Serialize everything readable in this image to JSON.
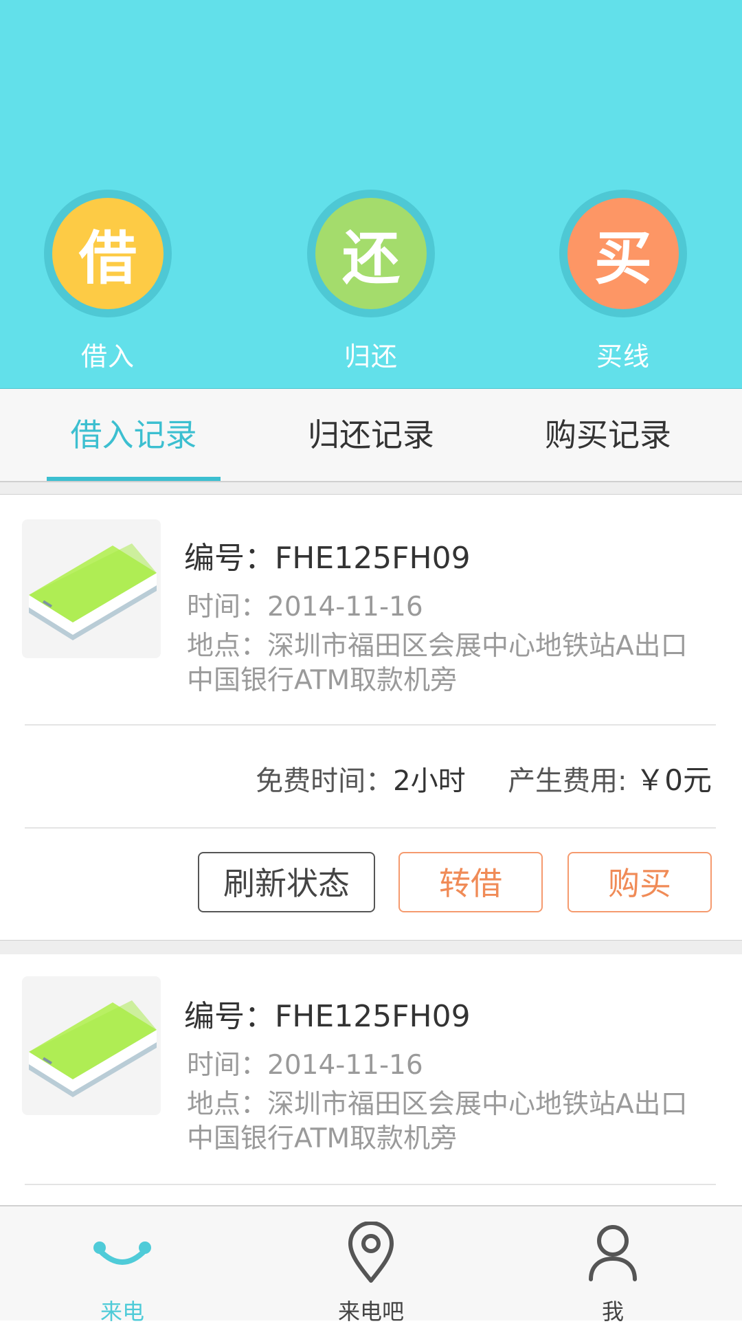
{
  "header": {
    "actions": [
      {
        "glyph": "借",
        "label": "借入",
        "color": "#fdcb45"
      },
      {
        "glyph": "还",
        "label": "归还",
        "color": "#a4dc6c"
      },
      {
        "glyph": "买",
        "label": "买线",
        "color": "#fd9665"
      }
    ],
    "background": "#62e0ea"
  },
  "tabs": {
    "items": [
      "借入记录",
      "归还记录",
      "购买记录"
    ],
    "active_index": 0,
    "active_color": "#3cbfd0"
  },
  "records": [
    {
      "thumbnail_icon": "power-bank-image",
      "id_text": "编号：FHE125FH09",
      "time_text": "时间：2014-11-16",
      "place_line1": "地点：深圳市福田区会展中心地铁站A出口",
      "place_line2": "中国银行ATM取款机旁",
      "free_time_label": "免费时间：",
      "free_time_value": "2小时",
      "fee_label": "产生费用:",
      "fee_value": "￥0元",
      "buttons": {
        "refresh": "刷新状态",
        "lend": "转借",
        "buy": "购买"
      }
    },
    {
      "thumbnail_icon": "power-bank-image",
      "id_text": "编号：FHE125FH09",
      "time_text": "时间：2014-11-16",
      "place_line1": "地点：深圳市福田区会展中心地铁站A出口",
      "place_line2": "中国银行ATM取款机旁"
    }
  ],
  "bottom_nav": {
    "items": [
      {
        "label": "来电",
        "icon": "smile-icon",
        "active": true
      },
      {
        "label": "来电吧",
        "icon": "location-pin-icon",
        "active": false
      },
      {
        "label": "我",
        "icon": "user-icon",
        "active": false
      }
    ],
    "active_color": "#4fcbd8"
  }
}
